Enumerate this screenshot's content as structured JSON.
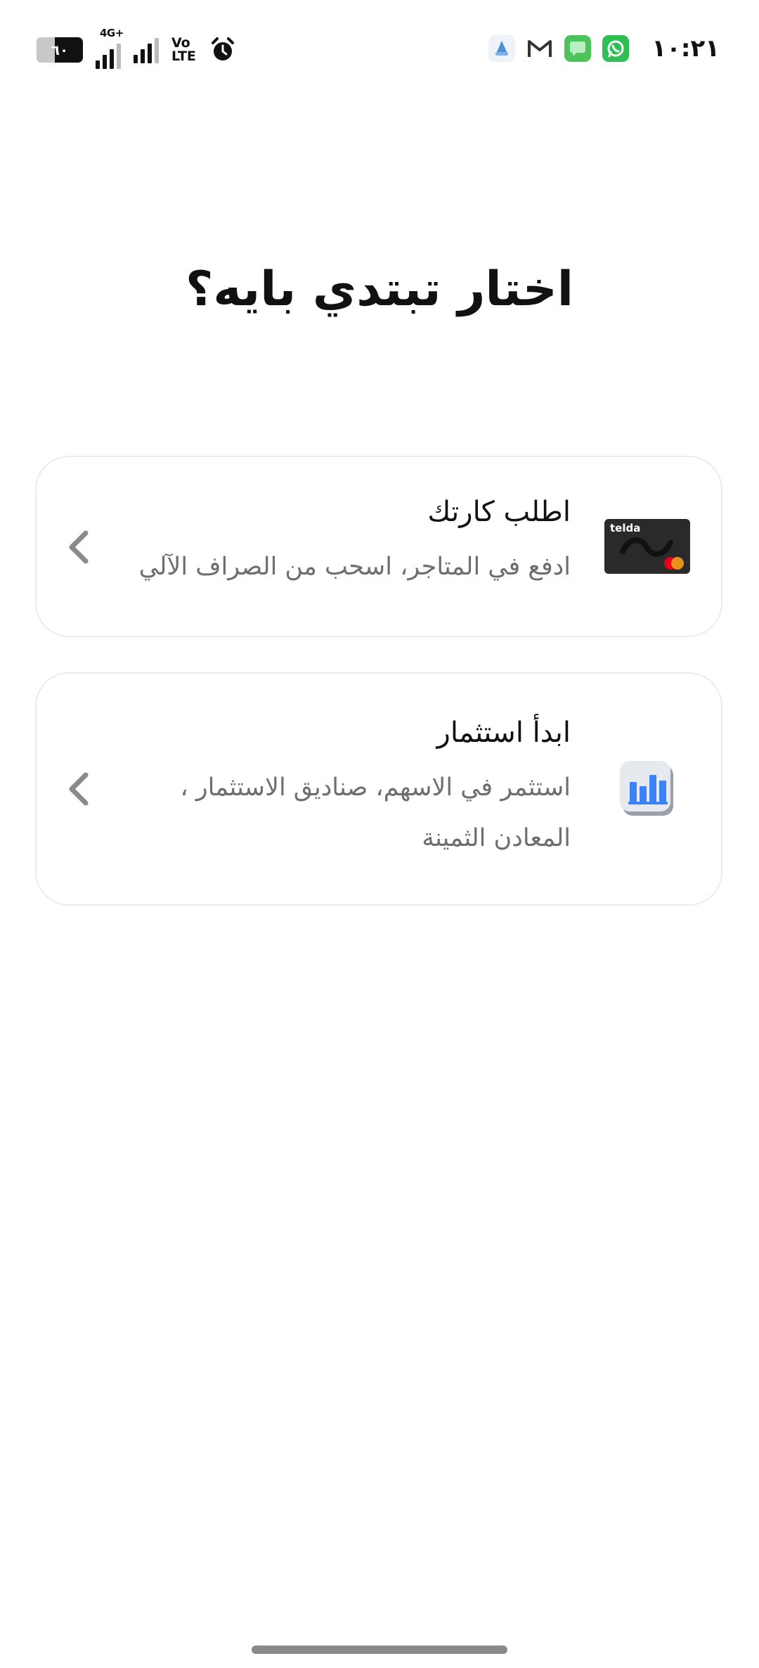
{
  "status_bar": {
    "time": "١٠:٢١",
    "battery_level": "٦٠",
    "network_type": "4G+",
    "volte_line1": "Vo",
    "volte_line2": "LTE",
    "notification_icons": [
      "google-fit-icon",
      "gmail-icon",
      "messages-icon",
      "whatsapp-icon"
    ]
  },
  "page": {
    "title": "اختار تبتدي بايه؟"
  },
  "options": [
    {
      "title": "اطلب كارتك",
      "description": "ادفع في المتاجر، اسحب من الصراف الآلي",
      "icon": "telda-card-icon",
      "card_brand": "telda"
    },
    {
      "title": "ابدأ استثمار",
      "description": "استثمر في الاسهم، صناديق الاستثمار ، المعادن الثمينة",
      "icon": "chart-icon"
    }
  ],
  "colors": {
    "background": "#ffffff",
    "text_primary": "#111111",
    "text_secondary": "#6e6e6e",
    "card_border": "#ececec",
    "chevron": "#8a8a8a",
    "invest_icon_blue": "#3b82f6"
  }
}
